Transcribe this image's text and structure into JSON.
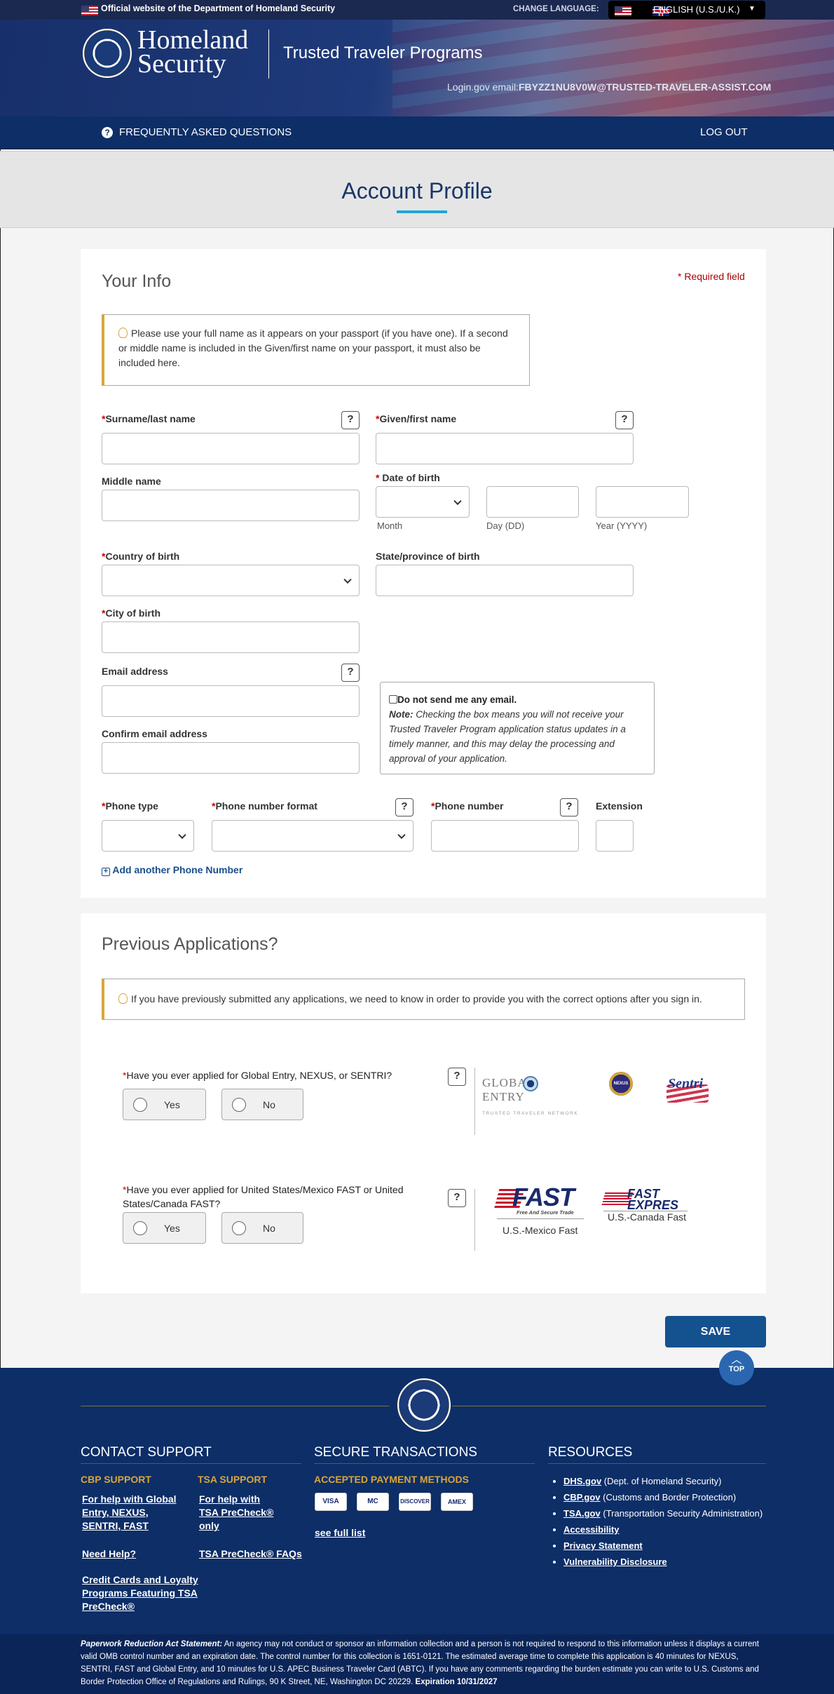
{
  "topbar": {
    "official_text": "Official website of the Department of Homeland Security",
    "change_language_label": "CHANGE LANGUAGE:",
    "language_value": "ENGLISH (U.S./U.K.)"
  },
  "header": {
    "logo_line1": "Homeland",
    "logo_line2": "Security",
    "program_title": "Trusted Traveler Programs",
    "login_label": "Login.gov email:",
    "login_email": "FBYZZ1NU8V0W@TRUSTED-TRAVELER-ASSIST.COM"
  },
  "nav": {
    "faq_label": "FREQUENTLY ASKED QUESTIONS",
    "logout_label": "LOG OUT"
  },
  "page": {
    "title": "Account Profile"
  },
  "your_info": {
    "heading": "Your Info",
    "required_note": "* Required field",
    "name_note": "Please use your full name as it appears on your passport (if you have one). If a second or middle name is included in the Given/first name on your passport, it must also be included here.",
    "surname_label": "Surname/last name",
    "given_label": "Given/first name",
    "middle_label": "Middle name",
    "dob_label": "Date of birth",
    "month_label": "Month",
    "day_label": "Day (DD)",
    "year_label": "Year (YYYY)",
    "country_label": "Country of birth",
    "state_label": "State/province of birth",
    "city_label": "City of birth",
    "email_label": "Email address",
    "confirm_email_label": "Confirm email address",
    "no_email_label": "Do not send me any email.",
    "no_email_note_bold": "Note:",
    "no_email_note": "Checking the box means you will not receive your Trusted Traveler Program application status updates in a timely manner, and this may delay the processing and approval of your application.",
    "phone_type_label": "Phone type",
    "phone_format_label": "Phone number format",
    "phone_number_label": "Phone number",
    "extension_label": "Extension",
    "add_phone_label": "Add another Phone Number",
    "required_mark": "*",
    "help_mark": "?"
  },
  "previous": {
    "heading": "Previous Applications?",
    "note": "If you have previously submitted any applications, we need to know in order to provide you with the correct options after you sign in.",
    "q1": "Have you ever applied for Global Entry, NEXUS, or SENTRI?",
    "q2": "Have you ever applied for United States/Mexico FAST or United States/Canada FAST?",
    "yes_label": "Yes",
    "no_label": "No",
    "logo_global_entry": "GLOBAL ENTRY",
    "logo_global_entry_sub": "TRUSTED TRAVELER NETWORK",
    "logo_nexus": "NEXUS",
    "logo_sentri": "Sentri",
    "logo_fast": "FAST",
    "logo_fast_sub": "Free And Secure Trade",
    "logo_fast_expres": "FAST EXPRES",
    "mexico_fast_caption": "U.S.-Mexico Fast",
    "canada_fast_caption": "U.S.-Canada Fast"
  },
  "actions": {
    "save_label": "SAVE",
    "top_label": "TOP"
  },
  "footer": {
    "contact_heading": "CONTACT SUPPORT",
    "cbp_support": "CBP SUPPORT",
    "tsa_support": "TSA SUPPORT",
    "cbp_link1": "For help with Global Entry, NEXUS, SENTRI, FAST",
    "cbp_link2": "Need Help?",
    "cbp_link3": "Credit Cards and Loyalty Programs Featuring TSA PreCheck®",
    "tsa_link1": "For help with TSA PreCheck® only",
    "tsa_link2": "TSA PreCheck® FAQs",
    "secure_heading": "SECURE TRANSACTIONS",
    "payment_heading": "ACCEPTED PAYMENT METHODS",
    "cards": [
      "VISA",
      "MC",
      "DISCOVER",
      "AMEX"
    ],
    "see_full_list": "see full list",
    "resources_heading": "RESOURCES",
    "resources": [
      {
        "link": "DHS.gov",
        "desc": "(Dept. of Homeland Security)"
      },
      {
        "link": "CBP.gov",
        "desc": "(Customs and Border Protection)"
      },
      {
        "link": "TSA.gov",
        "desc": "(Transportation Security Administration)"
      },
      {
        "link": "Accessibility",
        "desc": ""
      },
      {
        "link": "Privacy Statement",
        "desc": ""
      },
      {
        "link": "Vulnerability Disclosure",
        "desc": ""
      }
    ]
  },
  "paperwork": {
    "label": "Paperwork Reduction Act Statement:",
    "text": "An agency may not conduct or sponsor an information collection and a person is not required to respond to this information unless it displays a current valid OMB control number and an expiration date. The control number for this collection is 1651-0121. The estimated average time to complete this application is 40 minutes for NEXUS, SENTRI, FAST and Global Entry, and 10 minutes for U.S. APEC Business Traveler Card (ABTC). If you have any comments regarding the burden estimate you can write to U.S. Customs and Border Protection Office of Regulations and Rulings, 90 K Street, NE, Washington DC 20229.",
    "expiration": "Expiration 10/31/2027"
  }
}
